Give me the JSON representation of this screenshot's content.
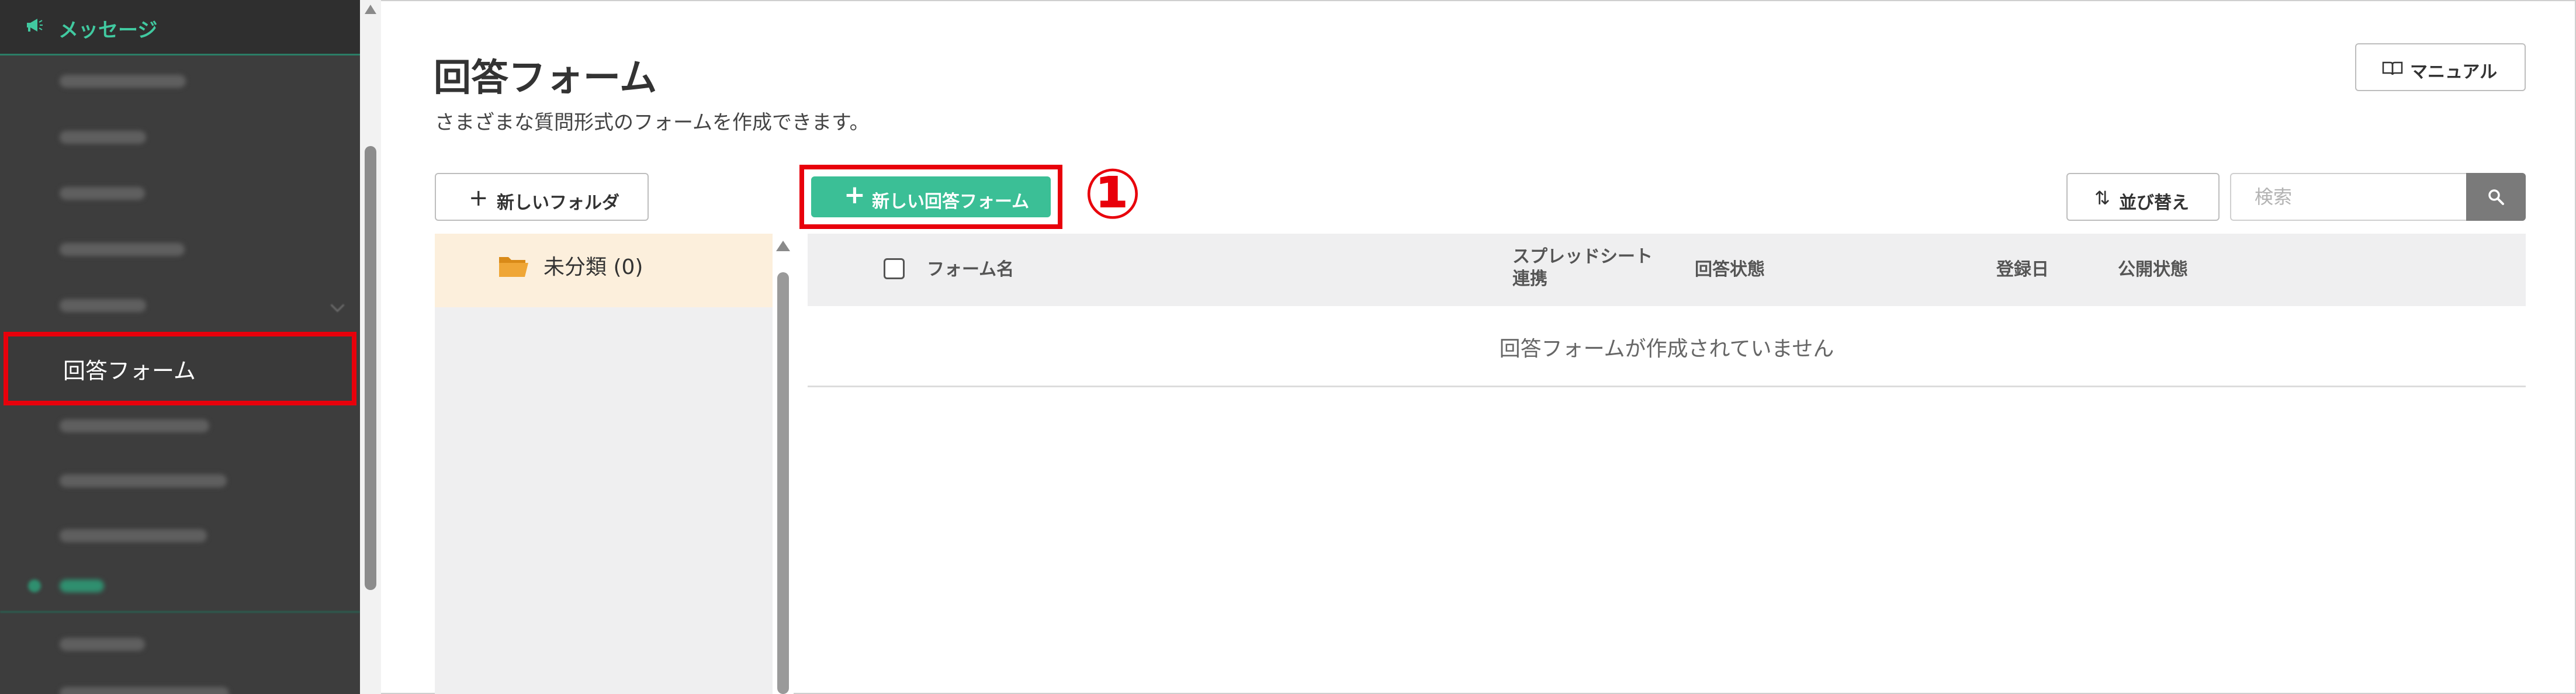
{
  "sidebar": {
    "header_label": "メッセージ",
    "active_item": "回答フォーム"
  },
  "page": {
    "title": "回答フォーム",
    "subtitle": "さまざまな質問形式のフォームを作成できます。",
    "manual_button": "マニュアル"
  },
  "toolbar": {
    "new_folder_label": "新しいフォルダ",
    "new_form_label": "新しい回答フォーム",
    "sort_label": "並び替え",
    "search_placeholder": "検索"
  },
  "annotation": "①",
  "folders": [
    {
      "label": "未分類 (0)"
    }
  ],
  "table": {
    "columns": [
      "フォーム名",
      "スプレッドシート",
      "連携",
      "回答状態",
      "登録日",
      "公開状態"
    ],
    "empty_message": "回答フォームが作成されていません"
  },
  "colors": {
    "accent": "#3bbf96",
    "sidebar_bg": "#3d3d3d",
    "highlight": "#e8000b"
  }
}
